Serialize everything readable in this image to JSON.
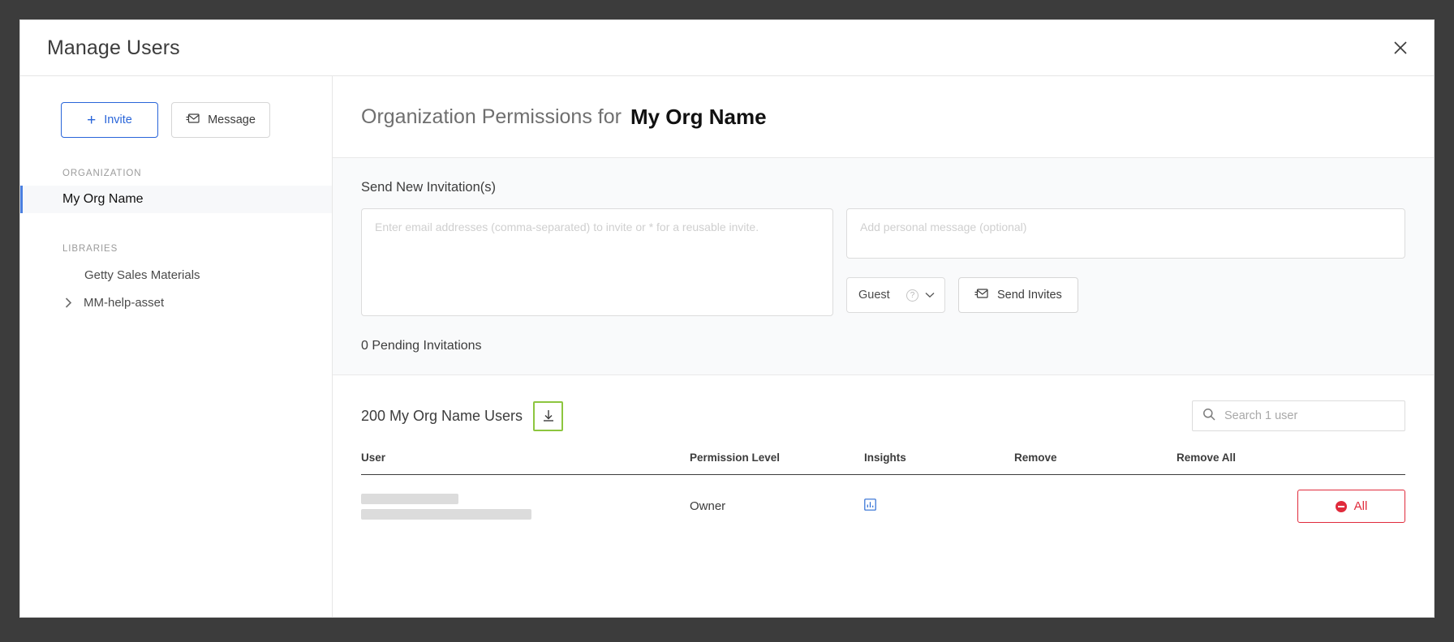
{
  "window": {
    "title": "Manage Users",
    "close_icon": "close-icon"
  },
  "sidebar": {
    "invite_button": "Invite",
    "message_button": "Message",
    "groups": [
      {
        "label": "ORGANIZATION",
        "items": [
          {
            "label": "My Org Name",
            "active": true
          }
        ]
      },
      {
        "label": "LIBRARIES",
        "items": [
          {
            "label": "Getty Sales Materials",
            "active": false
          },
          {
            "label": "MM-help-asset",
            "active": false,
            "icon": "chevron-right-icon"
          }
        ]
      }
    ],
    "org_label": "ORGANIZATION",
    "org_item": "My Org Name",
    "libraries_label": "LIBRARIES",
    "library_1": "Getty Sales Materials",
    "library_2": "MM-help-asset"
  },
  "main": {
    "heading_prefix": "Organization Permissions for",
    "heading_org": "My Org Name"
  },
  "invite_panel": {
    "title": "Send New Invitation(s)",
    "emails_placeholder": "Enter email addresses (comma-separated) to invite or * for a reusable invite.",
    "emails_value": "",
    "message_placeholder": "Add personal message (optional)",
    "message_value": "",
    "role_selected": "Guest",
    "role_help_icon": "question-circle-icon",
    "role_chevron_icon": "chevron-down-icon",
    "send_button": "Send Invites",
    "send_icon": "envelope-send-icon",
    "pending_text": "0 Pending Invitations"
  },
  "users_section": {
    "count_text": "200 My Org Name Users",
    "download_icon": "download-icon",
    "download_highlight_color": "#8dc63f",
    "search_placeholder": "Search 1 user",
    "search_value": "",
    "search_icon": "search-icon",
    "columns": [
      "User",
      "Permission Level",
      "Insights",
      "Remove",
      "Remove All"
    ],
    "rows": [
      {
        "user": "",
        "user_redacted": true,
        "permission_level": "Owner",
        "insights_icon": "bar-chart-icon",
        "remove": "",
        "remove_all_label": "All",
        "remove_all_icon": "minus-circle-icon"
      }
    ]
  },
  "colors": {
    "accent_blue": "#2965d9",
    "danger_red": "#e02b3c",
    "highlight_green": "#8dc63f",
    "insights_blue": "#2b6cd4",
    "backdrop": "#3c3c3c"
  }
}
